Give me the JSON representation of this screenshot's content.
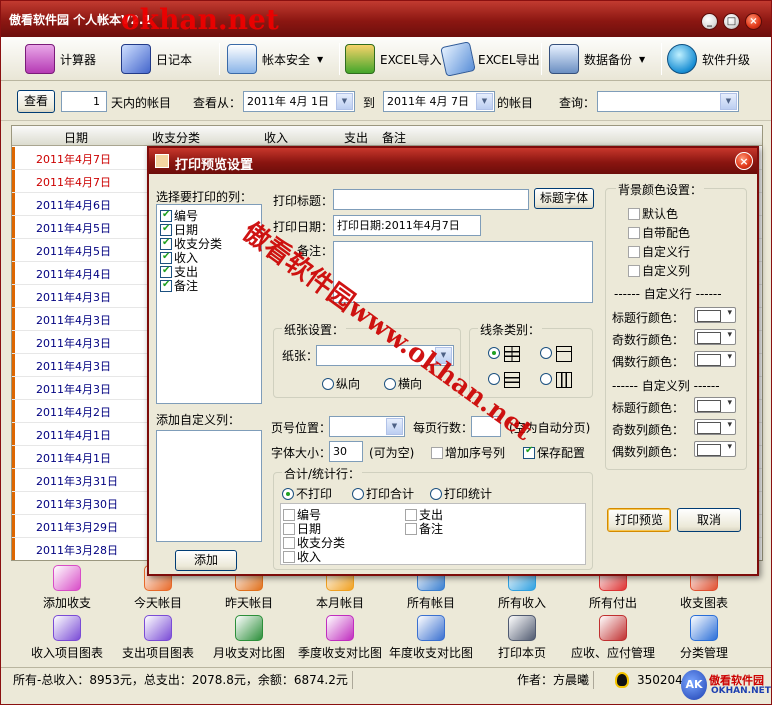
{
  "window": {
    "title": "傲看软件园 个人帐本V2.1",
    "min": "_",
    "max": "□",
    "close": "×"
  },
  "watermark_url": "okhan.net",
  "watermark_diag": "傲看软件园www.okhan.net",
  "toolbar": [
    {
      "label": "计算器",
      "icon": "calculator-icon"
    },
    {
      "label": "日记本",
      "icon": "diary-icon"
    },
    {
      "label": "帐本安全",
      "icon": "calendar-icon",
      "dropdown": true
    },
    {
      "label": "EXCEL导入",
      "icon": "excel-import-icon"
    },
    {
      "label": "EXCEL导出",
      "icon": "excel-export-icon"
    },
    {
      "label": "数据备份",
      "icon": "backup-icon",
      "dropdown": true
    },
    {
      "label": "软件升级",
      "icon": "upgrade-icon"
    }
  ],
  "filter": {
    "view_btn": "查看",
    "days": "1",
    "days_suffix": "天内的帐目",
    "from_label": "查看从：",
    "from_date": "2011年 4月 1日",
    "to_label": "到",
    "to_date": "2011年 4月 7日",
    "suffix": "的帐目",
    "query_label": "查询：",
    "query_value": ""
  },
  "grid": {
    "headers": [
      "日期",
      "收支分类",
      "收入",
      "支出",
      "备注"
    ],
    "rows": [
      "2011年4月7日",
      "2011年4月7日",
      "2011年4月6日",
      "2011年4月5日",
      "2011年4月5日",
      "2011年4月4日",
      "2011年4月3日",
      "2011年4月3日",
      "2011年4月3日",
      "2011年4月3日",
      "2011年4月3日",
      "2011年4月2日",
      "2011年4月1日",
      "2011年4月1日",
      "2011年3月31日",
      "2011年3月30日",
      "2011年3月29日",
      "2011年3月28日"
    ]
  },
  "bottom_row1": [
    "添加收支",
    "今天帐目",
    "昨天帐目",
    "本月帐目",
    "所有帐目",
    "所有收入",
    "所有付出",
    "收支图表"
  ],
  "bottom_row2": [
    "收入项目图表",
    "支出项目图表",
    "月收支对比图",
    "季度收支对比图",
    "年度收支对比图",
    "打印本页",
    "应收、应付管理",
    "分类管理"
  ],
  "status": {
    "summary": "所有-总收入：8953元，总支出：2078.8元，余额：6874.2元",
    "author": "作者：方晨曦",
    "qq": "350204",
    "logo_big": "傲看软件园",
    "logo_small": "OKHAN.NET"
  },
  "dialog": {
    "title": "打印预览设置",
    "select_cols_label": "选择要打印的列：",
    "columns": [
      "编号",
      "日期",
      "收支分类",
      "收入",
      "支出",
      "备注"
    ],
    "custom_cols_label": "添加自定义列：",
    "add_btn": "添加",
    "print_title_label": "打印标题：",
    "print_title_value": "",
    "title_font_btn": "标题字体",
    "print_date_label": "打印日期：",
    "print_date_value": "打印日期:2011年4月7日",
    "remark_label": "备注：",
    "paper_group": "纸张设置：",
    "paper_label": "纸张：",
    "orient_portrait": "纵向",
    "orient_landscape": "横向",
    "line_group": "线条类别：",
    "pagepos_label": "页号位置：",
    "perpage_label": "每页行数：",
    "perpage_hint": "(空为自动分页)",
    "fontsize_label": "字体大小：",
    "fontsize_value": "30",
    "fontsize_hint": "(可为空)",
    "add_serial": "增加序号列",
    "save_config": "保存配置",
    "total_group": "合计/统计行：",
    "no_print": "不打印",
    "print_total": "打印合计",
    "print_stat": "打印统计",
    "total_cols": [
      "编号",
      "支出",
      "日期",
      "备注",
      "收支分类",
      "收入"
    ],
    "bg_group": "背景颜色设置：",
    "bg_opts": [
      "默认色",
      "自带配色",
      "自定义行",
      "自定义列"
    ],
    "custom_row_sep": "------ 自定义行 ------",
    "custom_col_sep": "------ 自定义列 ------",
    "row_colors": [
      "标题行颜色：",
      "奇数行颜色：",
      "偶数行颜色："
    ],
    "col_colors": [
      "标题行颜色：",
      "奇数列颜色：",
      "偶数列颜色："
    ],
    "preview_btn": "打印预览",
    "cancel_btn": "取消"
  }
}
